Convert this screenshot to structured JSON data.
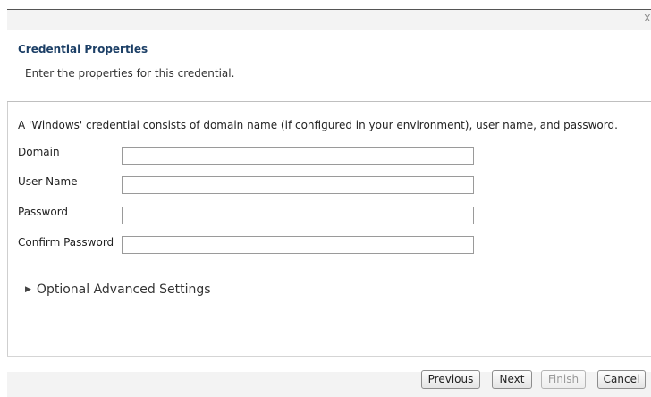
{
  "wizard": {
    "close_glyph": "X",
    "title": "Credential Properties",
    "description": "Enter the properties for this credential."
  },
  "form": {
    "intro": "A 'Windows' credential consists of domain name (if configured in your environment), user name, and password.",
    "fields": [
      {
        "label": "Domain",
        "value": ""
      },
      {
        "label": "User Name",
        "value": ""
      },
      {
        "label": "Password",
        "value": ""
      },
      {
        "label": "Confirm Password",
        "value": ""
      }
    ],
    "advanced_label": "Optional Advanced Settings"
  },
  "buttons": {
    "previous": "Previous",
    "next": "Next",
    "finish": "Finish",
    "cancel": "Cancel"
  }
}
